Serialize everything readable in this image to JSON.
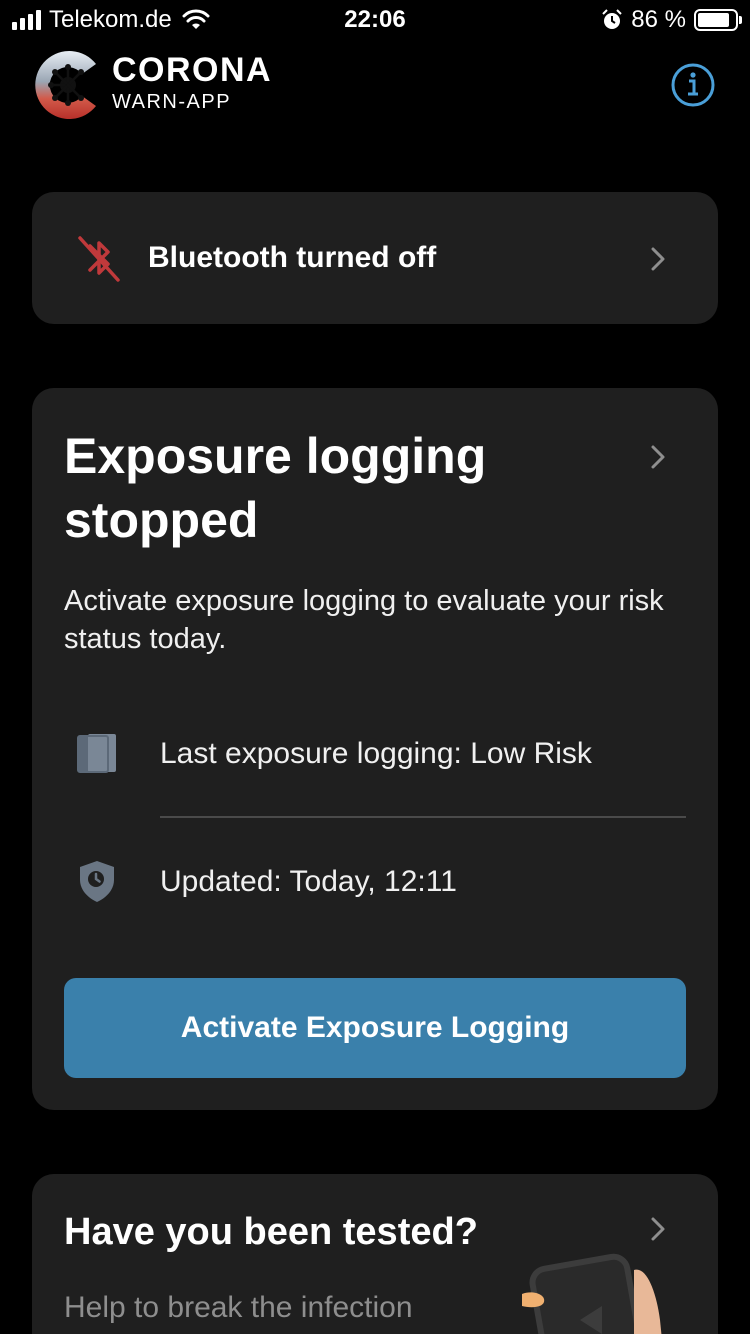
{
  "status_bar": {
    "carrier": "Telekom.de",
    "time": "22:06",
    "battery_percent": "86 %",
    "battery_level": 0.86,
    "icons": [
      "signal-icon",
      "wifi-icon",
      "alarm-icon",
      "battery-icon"
    ]
  },
  "header": {
    "app_name": "CORONA",
    "app_subname": "WARN-APP",
    "info_icon": "info-icon"
  },
  "bluetooth_card": {
    "label": "Bluetooth turned off",
    "icon": "bluetooth-off-icon",
    "icon_color": "#c0393b"
  },
  "exposure_card": {
    "title": "Exposure logging stopped",
    "description": "Activate exposure logging to evaluate your risk status today.",
    "rows": [
      {
        "icon": "document-icon",
        "text": "Last exposure logging: Low Risk"
      },
      {
        "icon": "shield-clock-icon",
        "text": "Updated: Today, 12:11"
      }
    ],
    "button_label": "Activate Exposure Logging",
    "button_color": "#3a80ab"
  },
  "test_card": {
    "title": "Have you been tested?",
    "description": "Help to break the infection chain by notifying others."
  },
  "colors": {
    "background": "#000000",
    "card": "#1f1f1f",
    "accent": "#3a80ab",
    "info_icon": "#4a9fd8"
  }
}
